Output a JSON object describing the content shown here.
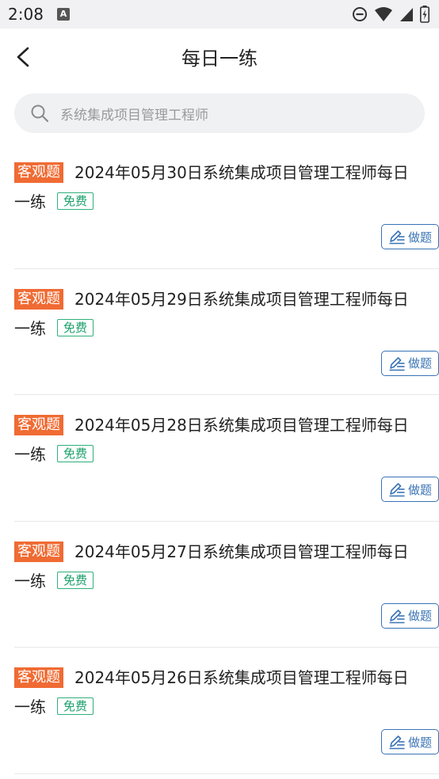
{
  "status_bar": {
    "time": "2:08",
    "a_icon": "A"
  },
  "header": {
    "title": "每日一练"
  },
  "search": {
    "placeholder": "系统集成项目管理工程师"
  },
  "list": {
    "items": [
      {
        "tag": "客观题",
        "title": "2024年05月30日系统集成项目管理工程师每日一练",
        "badge": "免费",
        "action": "做题"
      },
      {
        "tag": "客观题",
        "title": "2024年05月29日系统集成项目管理工程师每日一练",
        "badge": "免费",
        "action": "做题"
      },
      {
        "tag": "客观题",
        "title": "2024年05月28日系统集成项目管理工程师每日一练",
        "badge": "免费",
        "action": "做题"
      },
      {
        "tag": "客观题",
        "title": "2024年05月27日系统集成项目管理工程师每日一练",
        "badge": "免费",
        "action": "做题"
      },
      {
        "tag": "客观题",
        "title": "2024年05月26日系统集成项目管理工程师每日一练",
        "badge": "免费",
        "action": "做题"
      }
    ]
  },
  "colors": {
    "tag_bg": "#f06b33",
    "free_green": "#1aa06a",
    "button_blue": "#3a73b5",
    "search_bg": "#f0f1f3"
  },
  "icons": {
    "back": "chevron-left-icon",
    "search": "search-icon",
    "do": "pen-list-icon",
    "dnd": "do-not-disturb-icon",
    "wifi": "wifi-icon",
    "signal": "signal-icon",
    "battery": "battery-charging-icon"
  }
}
